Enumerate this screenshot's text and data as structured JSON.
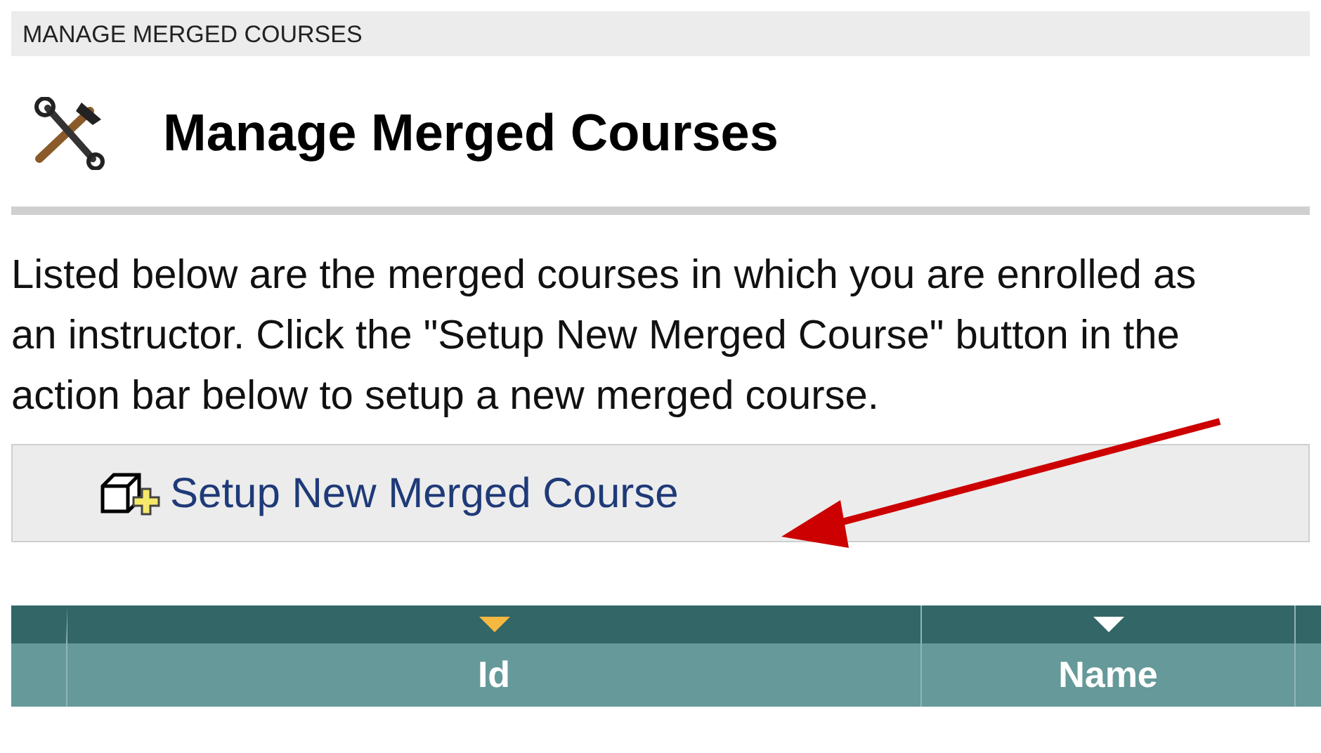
{
  "breadcrumb": "MANAGE MERGED COURSES",
  "title": "Manage Merged Courses",
  "description": "Listed below are the merged courses in which you are enrolled as an instructor. Click the \"Setup New Merged Course\" button in the action bar below to setup a new merged course.",
  "action_bar": {
    "button": "Setup New Merged Course"
  },
  "table": {
    "columns": [
      {
        "label": "Id",
        "selected": true
      },
      {
        "label": "Name",
        "selected": false
      }
    ]
  }
}
